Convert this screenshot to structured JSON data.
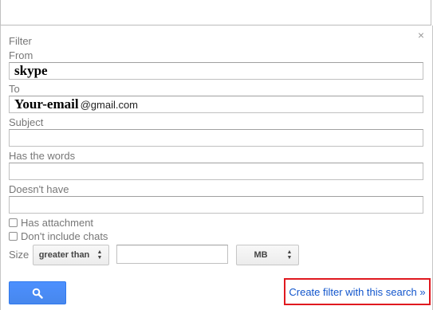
{
  "panel": {
    "title": "Filter",
    "close_glyph": "×",
    "close_icon": "close-icon"
  },
  "from": {
    "label": "From",
    "value": "skype"
  },
  "to": {
    "label": "To",
    "value_bold": "Your-email",
    "value_plain": "@gmail.com"
  },
  "subject": {
    "label": "Subject",
    "value": ""
  },
  "has_words": {
    "label": "Has the words",
    "value": ""
  },
  "doesnt_have": {
    "label": "Doesn't have",
    "value": ""
  },
  "options": {
    "has_attachment": "Has attachment",
    "no_chats": "Don't include chats"
  },
  "size": {
    "label": "Size",
    "comparator": "greater than",
    "value": "",
    "unit": "MB"
  },
  "actions": {
    "search_icon": "search-icon",
    "create_filter": "Create filter with this search »"
  },
  "colors": {
    "search_button": "#4d90fe",
    "link": "#1155cc",
    "highlight_box": "#e0191f"
  }
}
